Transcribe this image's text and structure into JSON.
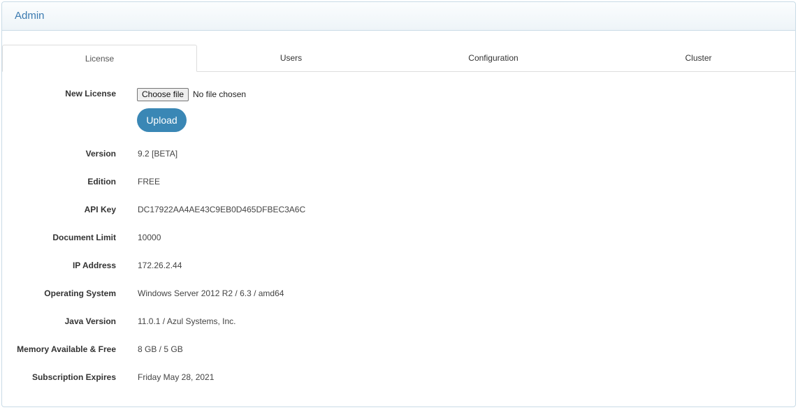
{
  "panel": {
    "title": "Admin"
  },
  "tabs": [
    {
      "label": "License",
      "active": true
    },
    {
      "label": "Users",
      "active": false
    },
    {
      "label": "Configuration",
      "active": false
    },
    {
      "label": "Cluster",
      "active": false
    }
  ],
  "license": {
    "new_license_label": "New License",
    "choose_file_label": "Choose file",
    "file_status": "No file chosen",
    "upload_label": "Upload",
    "fields": [
      {
        "label": "Version",
        "value": "9.2 [BETA]"
      },
      {
        "label": "Edition",
        "value": "FREE"
      },
      {
        "label": "API Key",
        "value": "DC17922AA4AE43C9EB0D465DFBEC3A6C"
      },
      {
        "label": "Document Limit",
        "value": "10000"
      },
      {
        "label": "IP Address",
        "value": "172.26.2.44"
      },
      {
        "label": "Operating System",
        "value": "Windows Server 2012 R2 / 6.3 / amd64"
      },
      {
        "label": "Java Version",
        "value": "11.0.1 / Azul Systems, Inc."
      },
      {
        "label": "Memory Available & Free",
        "value": "8 GB / 5 GB"
      },
      {
        "label": "Subscription Expires",
        "value": "Friday May 28, 2021"
      }
    ]
  },
  "colors": {
    "accent": "#3a87b5",
    "title": "#3a7ab0",
    "border": "#c9dbe6"
  }
}
